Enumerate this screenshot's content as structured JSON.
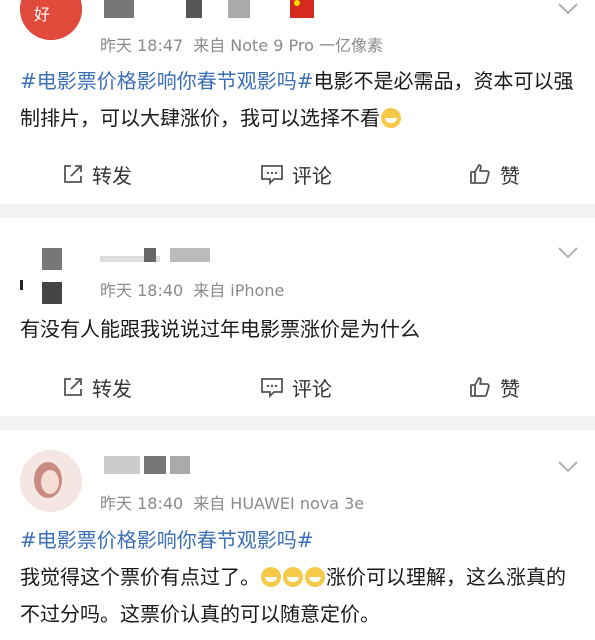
{
  "posts": [
    {
      "time": "昨天 18:47",
      "source": "来自 Note 9 Pro 一亿像素",
      "topic": "#电影票价格影响你春节观影吗#",
      "text": "电影不是必需品，资本可以强制排片，可以大肆涨价，我可以选择不看"
    },
    {
      "name": "是**是**",
      "time": "昨天 18:40",
      "source": "来自 iPhone",
      "text": "有没有人能跟我说说过年电影票涨价是为什么"
    },
    {
      "time": "昨天 18:40",
      "source": "来自 HUAWEI nova 3e",
      "topic": "#电影票价格影响你春节观影吗#",
      "text_a": "我觉得这个票价有点过了。",
      "text_b": "涨价可以理解，这么涨真的不过分吗。这票价认真的可以随意定价。"
    }
  ],
  "actions": {
    "repost": "转发",
    "comment": "评论",
    "like": "赞"
  },
  "colors": {
    "topic": "#3b6fb6",
    "meta": "#8a8a8a",
    "divider": "#f2f2f2"
  }
}
